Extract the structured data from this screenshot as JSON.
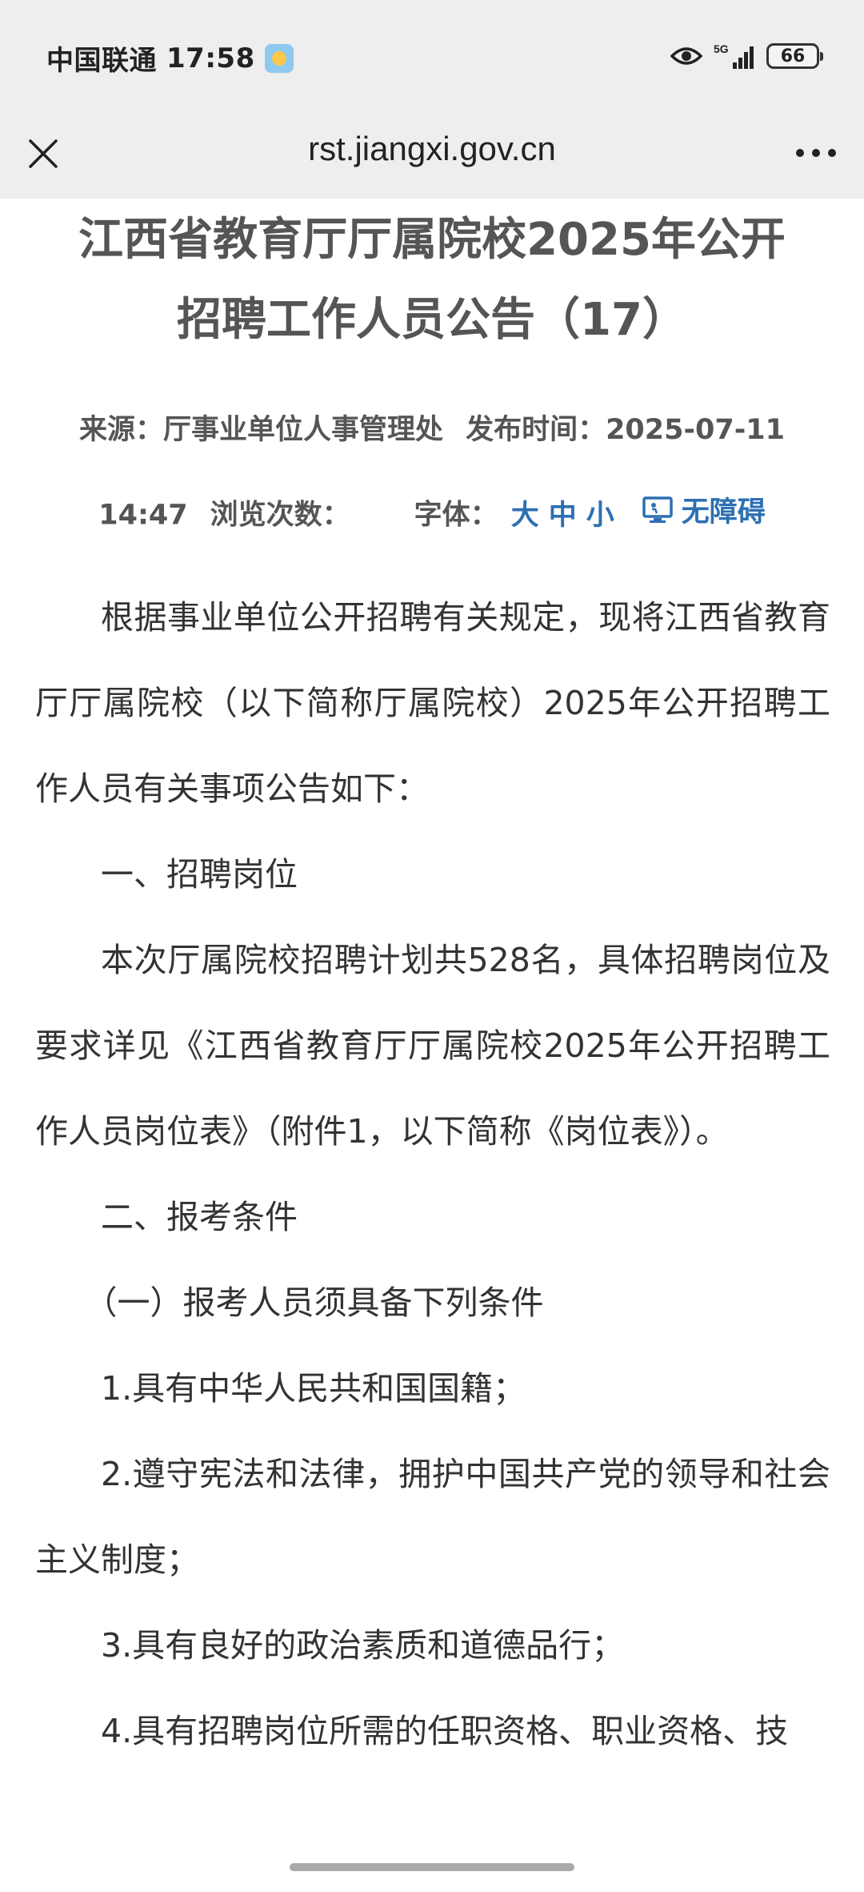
{
  "status_bar": {
    "carrier": "中国联通",
    "time": "17:58",
    "network": "5G",
    "battery": "66"
  },
  "toolbar": {
    "url": "rst.jiangxi.gov.cn"
  },
  "article": {
    "title_line1": "江西省教育厅厅属院校2025年公开",
    "title_line2": "招聘工作人员公告（17）",
    "source_label": "来源：",
    "source": "厅事业单位人事管理处",
    "publish_label": "发布时间：",
    "publish_date": "2025-07-11",
    "publish_time": "14:47",
    "views_label": "浏览次数：",
    "font_label": "字体：",
    "font_large": "大",
    "font_medium": "中",
    "font_small": "小",
    "accessibility": "无障碍",
    "paragraphs": [
      "根据事业单位公开招聘有关规定，现将江西省教育厅厅属院校（以下简称厅属院校）2025年公开招聘工作人员有关事项公告如下：",
      "一、招聘岗位",
      "本次厅属院校招聘计划共528名，具体招聘岗位及要求详见《江西省教育厅厅属院校2025年公开招聘工作人员岗位表》（附件1，以下简称《岗位表》）。",
      "二、报考条件",
      "（一）报考人员须具备下列条件",
      "1.具有中华人民共和国国籍；",
      "2.遵守宪法和法律，拥护中国共产党的领导和社会主义制度；",
      "3.具有良好的政治素质和道德品行；",
      "4.具有招聘岗位所需的任职资格、职业资格、技"
    ]
  },
  "colors": {
    "link_blue": "#2d6fb3",
    "title_gray": "#555555",
    "bar_gray": "#eeeeee"
  }
}
